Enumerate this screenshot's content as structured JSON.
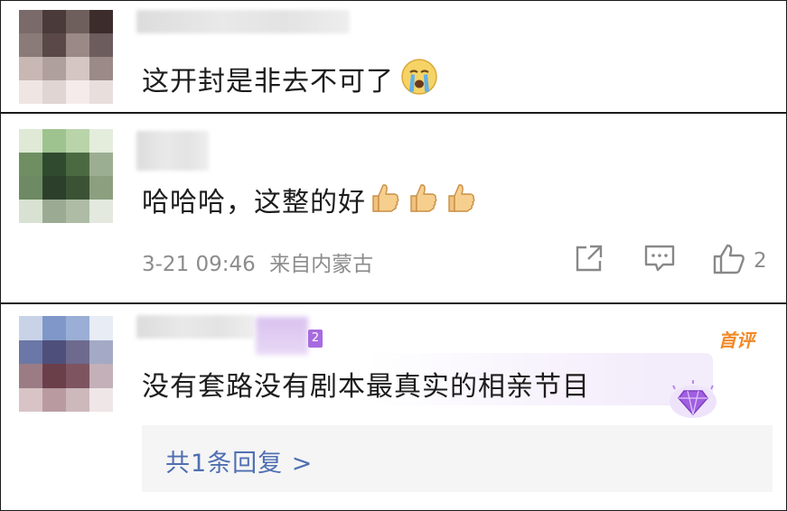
{
  "comments": [
    {
      "text": "这开封是非去不可了",
      "emoji": [
        "crying-face-icon"
      ],
      "avatar_colors": [
        "#7a6a6a",
        "#4a3a3a",
        "#6f5f5c",
        "#3d2c2c",
        "#8a7a78",
        "#5a4848",
        "#9a8986",
        "#6d5c5e",
        "#c8b7b3",
        "#b0a09d",
        "#d6c6c3",
        "#9b8a88",
        "#efe6e4",
        "#e1d5d3",
        "#f3eceb",
        "#e8dfdd"
      ]
    },
    {
      "text": "哈哈哈，这整的好",
      "emoji": [
        "thumbs-up-icon",
        "thumbs-up-icon",
        "thumbs-up-icon"
      ],
      "timestamp": "3-21 09:46",
      "location": "来自内蒙古",
      "likes": "2",
      "avatar_colors": [
        "#dfe9d6",
        "#9ec38e",
        "#b9d4a8",
        "#e4ecdc",
        "#6f8f62",
        "#2f4a2e",
        "#4c6a42",
        "#9cae92",
        "#6e8a64",
        "#2b3f2a",
        "#3b5234",
        "#8ca07f",
        "#d9e2d2",
        "#9bab93",
        "#aebca6",
        "#e3e9de"
      ]
    },
    {
      "text": "没有套路没有剧本最真实的相亲节目",
      "level": "2",
      "top_tag": "首评",
      "reply_link": "共1条回复 >",
      "avatar_colors": [
        "#c8d3e8",
        "#7f98c9",
        "#9aaed6",
        "#e7ecf5",
        "#6b77a6",
        "#4e4f7a",
        "#6d6a8e",
        "#a4aac6",
        "#9b7c85",
        "#6a3f4a",
        "#7e5460",
        "#c4b0b8",
        "#d8c4c6",
        "#b89aa0",
        "#cdb8bb",
        "#efe6e8"
      ]
    }
  ],
  "colors": {
    "accent_link": "#4f6fb2",
    "top_tag": "#f08a2a",
    "level_badge": "#a76be0",
    "meta": "#8c8c8c"
  }
}
